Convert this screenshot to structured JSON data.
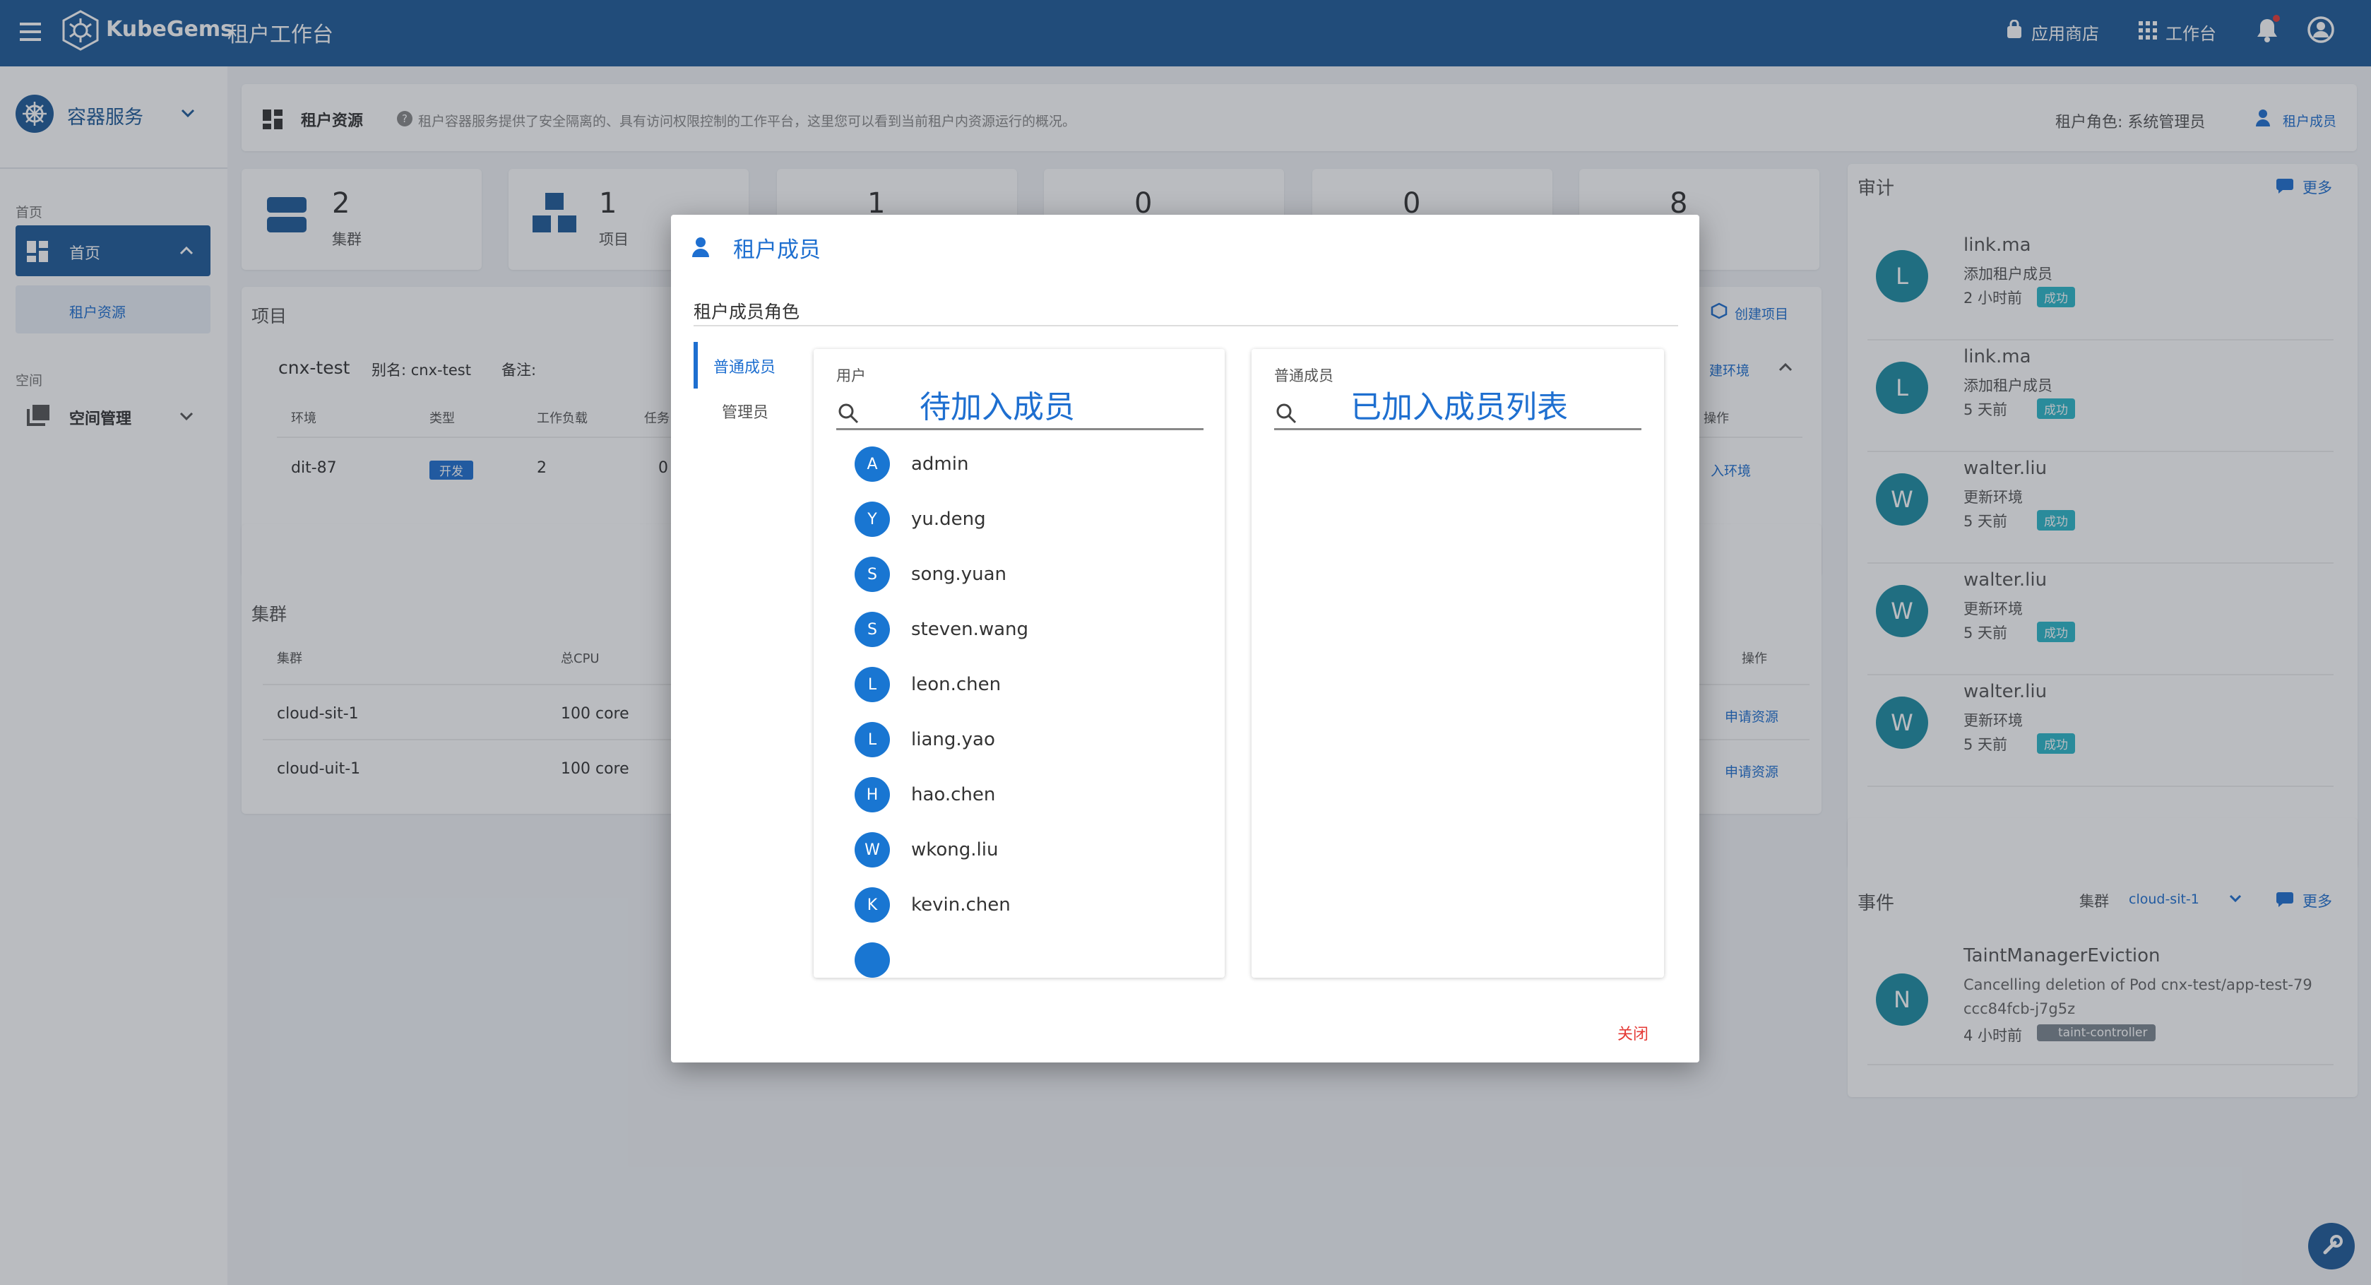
{
  "topbar": {
    "brand": "KubeGems",
    "subtitle": "租户工作台",
    "app_store": "应用商店",
    "workspace": "工作台"
  },
  "sidebar": {
    "service": "容器服务",
    "section_home": "首页",
    "home_item": "首页",
    "home_sub": "租户资源",
    "section_space": "空间",
    "space_item": "空间管理"
  },
  "header": {
    "title": "租户资源",
    "desc": "租户容器服务提供了安全隔离的、具有访问权限控制的工作平台，这里您可以看到当前租户内资源运行的概况。",
    "role": "租户角色: 系统管理员",
    "members_link": "租户成员"
  },
  "stats": [
    {
      "num": "2",
      "label": "集群"
    },
    {
      "num": "1",
      "label": "项目"
    },
    {
      "num": "1",
      "label": ""
    },
    {
      "num": "0",
      "label": ""
    },
    {
      "num": "0",
      "label": ""
    },
    {
      "num": "8",
      "label": ""
    }
  ],
  "projects": {
    "title": "项目",
    "create": "创建项目",
    "create_env": "建环境",
    "name": "cnx-test",
    "alias": "别名: cnx-test",
    "note": "备注:",
    "headers": [
      "环境",
      "类型",
      "工作负载",
      "任务"
    ],
    "op_header": "操作",
    "row": {
      "env": "dit-87",
      "type": "开发",
      "workloads": "2",
      "tasks": "0",
      "op": "入环境"
    }
  },
  "clusters": {
    "title": "集群",
    "headers": [
      "集群",
      "总CPU"
    ],
    "op_header": "操作",
    "rows": [
      {
        "name": "cloud-sit-1",
        "cpu": "100 core",
        "op": "申请资源"
      },
      {
        "name": "cloud-uit-1",
        "cpu": "100 core",
        "op": "申请资源"
      }
    ]
  },
  "audit": {
    "title": "审计",
    "more": "更多",
    "items": [
      {
        "avatar": "L",
        "name": "link.ma",
        "action": "添加租户成员",
        "time": "2 小时前",
        "status": "成功"
      },
      {
        "avatar": "L",
        "name": "link.ma",
        "action": "添加租户成员",
        "time": "5 天前",
        "status": "成功"
      },
      {
        "avatar": "W",
        "name": "walter.liu",
        "action": "更新环境",
        "time": "5 天前",
        "status": "成功"
      },
      {
        "avatar": "W",
        "name": "walter.liu",
        "action": "更新环境",
        "time": "5 天前",
        "status": "成功"
      },
      {
        "avatar": "W",
        "name": "walter.liu",
        "action": "更新环境",
        "time": "5 天前",
        "status": "成功"
      }
    ]
  },
  "events": {
    "title": "事件",
    "cluster_label": "集群",
    "cluster_value": "cloud-sit-1",
    "more": "更多",
    "item": {
      "avatar": "N",
      "name": "TaintManagerEviction",
      "desc1": "Cancelling deletion of Pod cnx-test/app-test-79",
      "desc2": "ccc84fcb-j7g5z",
      "time": "4 小时前",
      "tag": "taint-controller"
    }
  },
  "dialog": {
    "title": "租户成员",
    "role_section": "租户成员角色",
    "tabs": [
      "普通成员",
      "管理员"
    ],
    "left_label": "用户",
    "left_hint": "待加入成员",
    "right_label": "普通成员",
    "right_hint": "已加入成员列表",
    "users": [
      {
        "initial": "A",
        "name": "admin"
      },
      {
        "initial": "Y",
        "name": "yu.deng"
      },
      {
        "initial": "S",
        "name": "song.yuan"
      },
      {
        "initial": "S",
        "name": "steven.wang"
      },
      {
        "initial": "L",
        "name": "leon.chen"
      },
      {
        "initial": "L",
        "name": "liang.yao"
      },
      {
        "initial": "H",
        "name": "hao.chen"
      },
      {
        "initial": "W",
        "name": "wkong.liu"
      },
      {
        "initial": "K",
        "name": "kevin.chen"
      }
    ],
    "close": "关闭"
  },
  "colors": {
    "brand": "#1e5b99",
    "accent": "#1e6fd0",
    "success": "#2cb7c9",
    "avatar": "#1976d2",
    "close": "#e53935"
  }
}
